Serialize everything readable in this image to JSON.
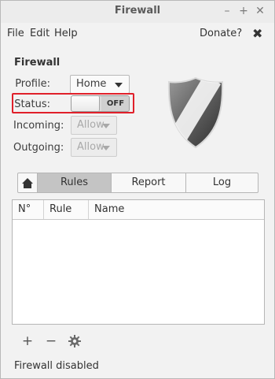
{
  "window": {
    "title": "Firewall",
    "controls": {
      "minimize": "–",
      "maximize": "+",
      "close": "✕"
    }
  },
  "menu": {
    "items": [
      "File",
      "Edit",
      "Help"
    ],
    "donate": "Donate?",
    "close_glyph": "✖"
  },
  "section_title": "Firewall",
  "form": {
    "profile": {
      "label": "Profile:",
      "value": "Home"
    },
    "status": {
      "label": "Status:",
      "state": "OFF",
      "enabled": false
    },
    "incoming": {
      "label": "Incoming:",
      "value": "Allow",
      "disabled": true
    },
    "outgoing": {
      "label": "Outgoing:",
      "value": "Allow",
      "disabled": true
    }
  },
  "tabs": {
    "home_icon": "home-icon",
    "items": [
      {
        "label": "Rules",
        "active": true
      },
      {
        "label": "Report",
        "active": false
      },
      {
        "label": "Log",
        "active": false
      }
    ]
  },
  "table": {
    "columns": [
      "N°",
      "Rule",
      "Name"
    ],
    "rows": []
  },
  "toolbar": {
    "add": "+",
    "remove": "−",
    "settings_icon": "gear-icon"
  },
  "statusbar": "Firewall disabled",
  "colors": {
    "highlight": "#e0202a",
    "active_tab": "#c4c4c4"
  }
}
